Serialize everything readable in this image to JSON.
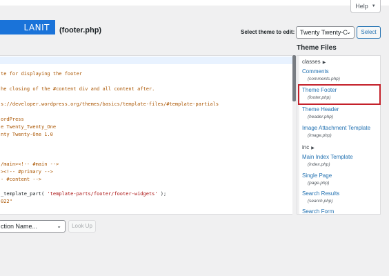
{
  "help": {
    "label": "Help",
    "icon": "caret-down-icon"
  },
  "logo": {
    "text": "LANIT"
  },
  "heading": {
    "text": "(footer.php)"
  },
  "theme_select": {
    "label": "Select theme to edit:",
    "value": "Twenty Twenty-C",
    "button": "Select"
  },
  "editor": {
    "lines": [
      {
        "text": "te for displaying the footer",
        "kind": "comment"
      },
      {
        "text": "he closing of the #content div and all content after.",
        "kind": "comment"
      },
      {
        "text": "s://developer.wordpress.org/themes/basics/template-files/#template-partials",
        "kind": "comment"
      },
      {
        "text": "ordPress",
        "kind": "comment"
      },
      {
        "text": "e Twenty_Twenty_One",
        "kind": "comment"
      },
      {
        "text": "nty Twenty-One 1.0",
        "kind": "comment"
      },
      {
        "text": "/main><!-- #main -->",
        "kind": "comment"
      },
      {
        "text": "><!-- #primary -->",
        "kind": "comment"
      },
      {
        "text": "- #content -->",
        "kind": "comment"
      },
      {
        "text_a": "_template_part( ",
        "text_b": "'template-parts/footer/footer-widgets'",
        "text_c": " );",
        "kind": "mixed"
      },
      {
        "text": "022\"",
        "kind": "comment"
      }
    ]
  },
  "files": {
    "title": "Theme Files",
    "folders": [
      {
        "name": "classes"
      },
      {
        "name": "inc"
      }
    ],
    "items": [
      {
        "label": "Comments",
        "path": "(comments.php)"
      },
      {
        "label": "Theme Footer",
        "path": "(footer.php)"
      },
      {
        "label": "Theme Header",
        "path": "(header.php)"
      },
      {
        "label": "Image Attachment Template",
        "path": "(image.php)"
      },
      {
        "label": "Main Index Template",
        "path": "(index.php)"
      },
      {
        "label": "Single Page",
        "path": "(page.php)"
      },
      {
        "label": "Search Results",
        "path": "(search.php)"
      },
      {
        "label": "Search Form",
        "path": ""
      }
    ]
  },
  "bottom": {
    "section_select": "ction Name...",
    "lookup": "Look Up"
  },
  "colors": {
    "link": "#2271b1",
    "highlight": "#c4202a",
    "logo_bg": "#1a73d9"
  }
}
